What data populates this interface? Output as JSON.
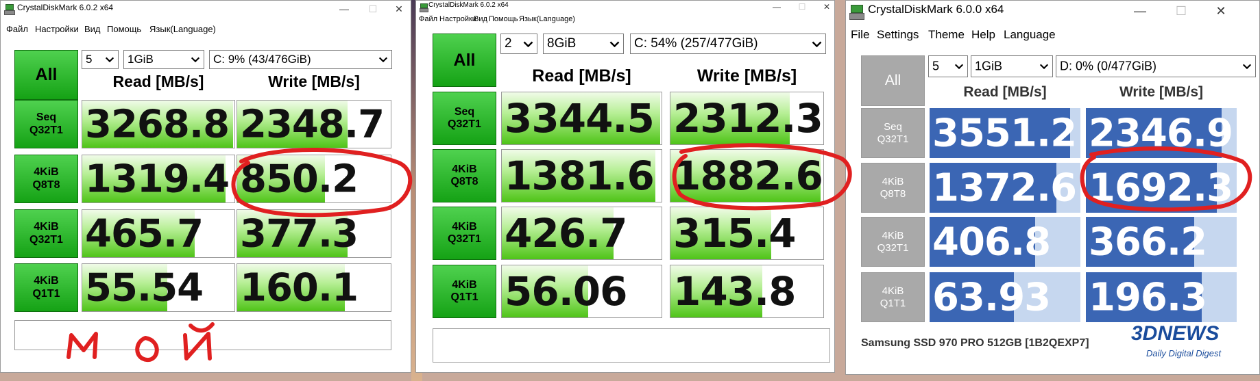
{
  "windows": [
    {
      "title": "CrystalDiskMark 6.0.2 x64",
      "menu": [
        "Файл",
        "Настройки",
        "Вид",
        "Помощь",
        "Язык(Language)"
      ],
      "all_label": "All",
      "count": "5",
      "size": "1GiB",
      "drive": "C: 9% (43/476GiB)",
      "read_header": "Read [MB/s]",
      "write_header": "Write [MB/s]",
      "rows": [
        {
          "line1": "Seq",
          "line2": "Q32T1",
          "read": "3268.8",
          "write": "2348.7",
          "read_level": 0.99,
          "write_level": 0.72
        },
        {
          "line1": "4KiB",
          "line2": "Q8T8",
          "read": "1319.4",
          "write": "850.2",
          "read_level": 0.94,
          "write_level": 0.57
        },
        {
          "line1": "4KiB",
          "line2": "Q32T1",
          "read": "465.7",
          "write": "377.3",
          "read_level": 0.74,
          "write_level": 0.72
        },
        {
          "line1": "4KiB",
          "line2": "Q1T1",
          "read": "55.54",
          "write": "160.1",
          "read_level": 0.56,
          "write_level": 0.7
        }
      ],
      "comment": "",
      "handwriting": "МОЙ"
    },
    {
      "title": "CrystalDiskMark 6.0.2 x64",
      "menu": [
        "Файл",
        "Настройки",
        "Вид",
        "Помощь",
        "Язык(Language)"
      ],
      "all_label": "All",
      "count": "2",
      "size": "8GiB",
      "drive": "C: 54% (257/477GiB)",
      "read_header": "Read [MB/s]",
      "write_header": "Write [MB/s]",
      "rows": [
        {
          "line1": "Seq",
          "line2": "Q32T1",
          "read": "3344.5",
          "write": "2312.3",
          "read_level": 0.99,
          "write_level": 0.78
        },
        {
          "line1": "4KiB",
          "line2": "Q8T8",
          "read": "1381.6",
          "write": "1882.6",
          "read_level": 0.96,
          "write_level": 0.98
        },
        {
          "line1": "4KiB",
          "line2": "Q32T1",
          "read": "426.7",
          "write": "315.4",
          "read_level": 0.7,
          "write_level": 0.66
        },
        {
          "line1": "4KiB",
          "line2": "Q1T1",
          "read": "56.06",
          "write": "143.8",
          "read_level": 0.54,
          "write_level": 0.6
        }
      ],
      "comment": ""
    },
    {
      "title": "CrystalDiskMark 6.0.0 x64",
      "menu": [
        "File",
        "Settings",
        "Theme",
        "Help",
        "Language"
      ],
      "all_label": "All",
      "count": "5",
      "size": "1GiB",
      "drive": "D: 0% (0/477GiB)",
      "read_header": "Read [MB/s]",
      "write_header": "Write [MB/s]",
      "rows": [
        {
          "line1": "Seq",
          "line2": "Q32T1",
          "read": "3551.2",
          "write": "2346.9",
          "read_level": 0.93,
          "write_level": 0.9
        },
        {
          "line1": "4KiB",
          "line2": "Q8T8",
          "read": "1372.6",
          "write": "1692.3",
          "read_level": 0.84,
          "write_level": 0.87
        },
        {
          "line1": "4KiB",
          "line2": "Q32T1",
          "read": "406.8",
          "write": "366.2",
          "read_level": 0.7,
          "write_level": 0.72
        },
        {
          "line1": "4KiB",
          "line2": "Q1T1",
          "read": "63.93",
          "write": "196.3",
          "read_level": 0.56,
          "write_level": 0.77
        }
      ],
      "comment": "Samsung SSD 970 PRO 512GB [1B2QEXP7]",
      "logo": "3DNEWS",
      "logo_sub": "Daily Digital Digest"
    }
  ],
  "colors": {
    "green_button": "#15a215",
    "green_bar": "#4fc418",
    "blue_bar": "#3b66b4",
    "blue_bar_bg": "#c6d7ef",
    "gray_button": "#a9a9a9",
    "annotation_red": "#e02020"
  }
}
